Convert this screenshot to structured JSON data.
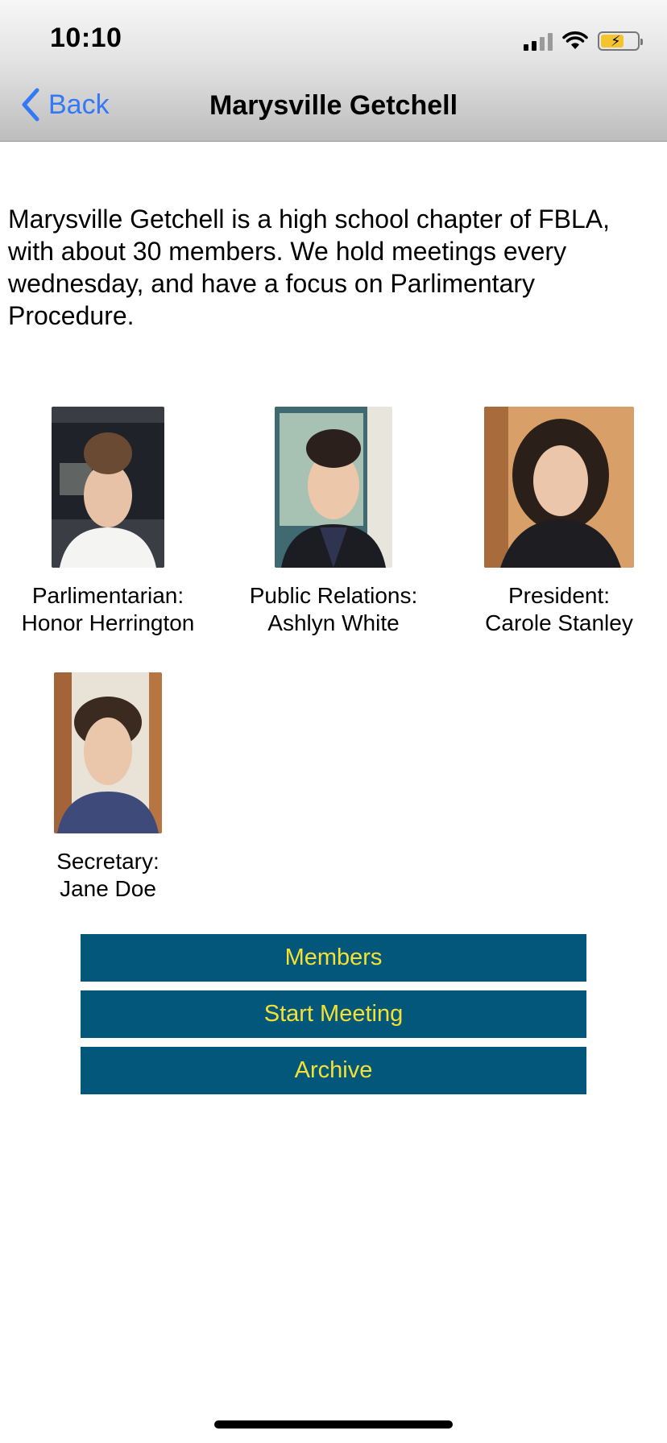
{
  "status_bar": {
    "time": "10:10"
  },
  "nav": {
    "back_label": "Back",
    "title": "Marysville Getchell"
  },
  "description": "Marysville Getchell is a high school chapter of FBLA, with about 30 members. We hold meetings every wednesday, and have a focus on Parlimentary Procedure.",
  "officers": [
    {
      "role": "Parlimentarian:",
      "name": "Honor Herrington"
    },
    {
      "role": "Public Relations:",
      "name": "Ashlyn White"
    },
    {
      "role": "President:",
      "name": "Carole Stanley"
    },
    {
      "role": "Secretary:",
      "name": "Jane Doe"
    }
  ],
  "buttons": {
    "members": "Members",
    "start_meeting": "Start Meeting",
    "archive": "Archive"
  },
  "colors": {
    "accent_link": "#3478f6",
    "button_bg": "#02577a",
    "button_text": "#f4e134"
  }
}
